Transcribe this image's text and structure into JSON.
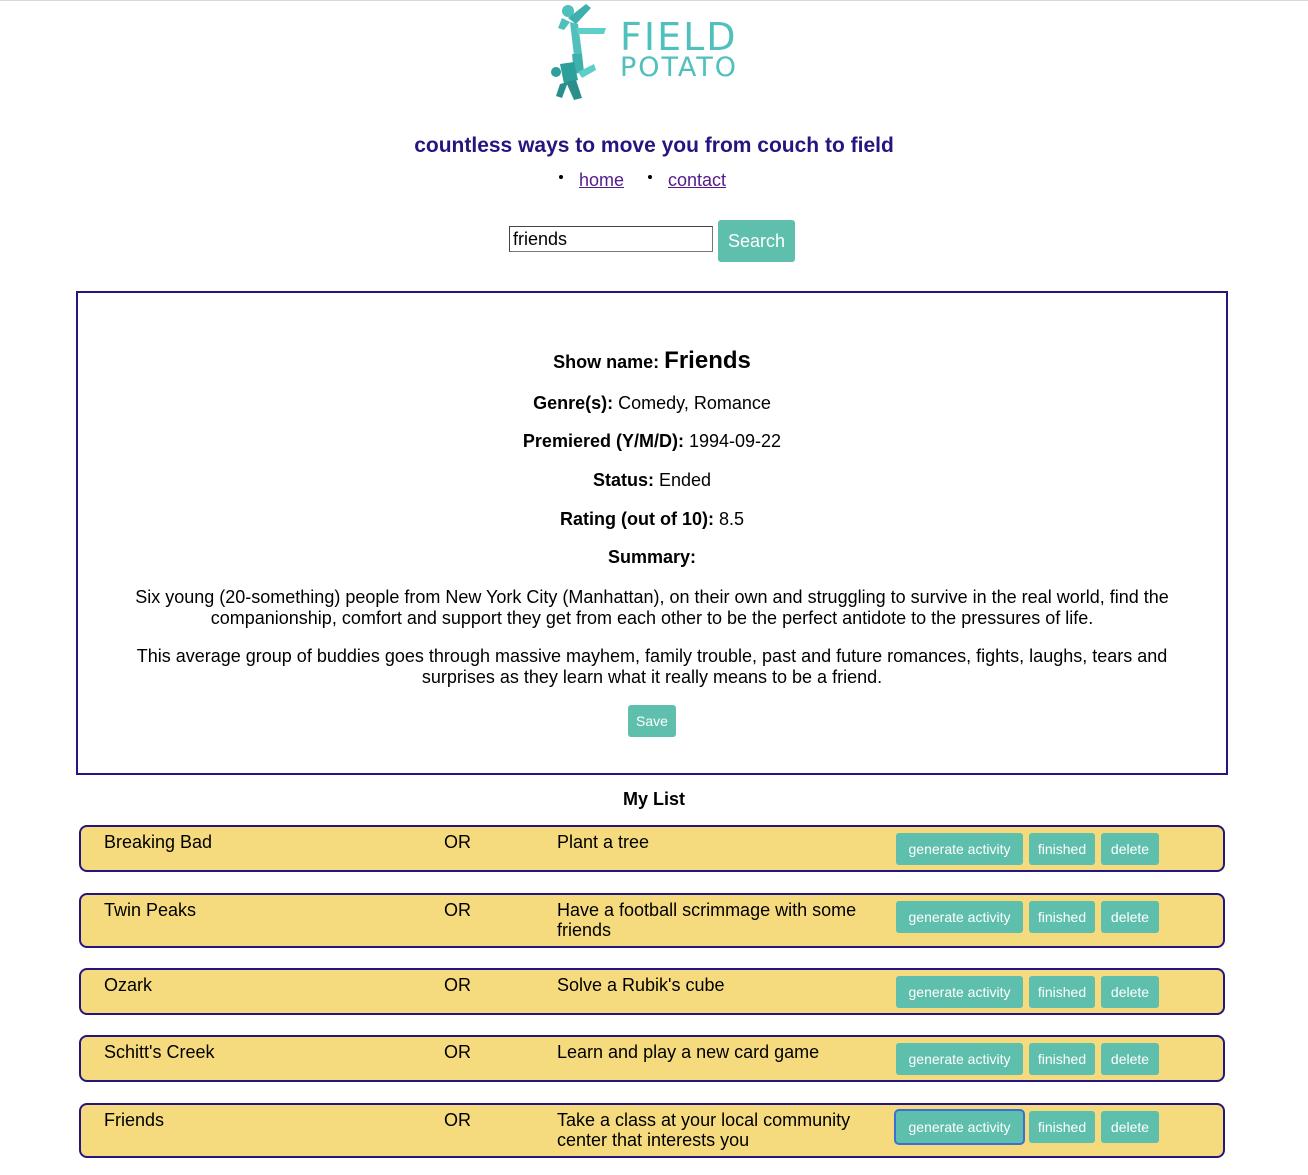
{
  "logo": {
    "line1": "FIELD",
    "line2": "POTATO",
    "color": "#4fc0bb",
    "icon": "people-jumping-logo"
  },
  "header": {
    "tagline": "countless ways to move you from couch to field",
    "nav": [
      {
        "label": "home"
      },
      {
        "label": "contact"
      }
    ]
  },
  "search": {
    "value": "friends",
    "button_label": "Search"
  },
  "show": {
    "name_label": "Show name:",
    "name": "Friends",
    "genres_label": "Genre(s):",
    "genres": "Comedy, Romance",
    "premiered_label": "Premiered (Y/M/D):",
    "premiered": "1994-09-22",
    "status_label": "Status:",
    "status": "Ended",
    "rating_label": "Rating (out of 10):",
    "rating": "8.5",
    "summary_label": "Summary:",
    "summary_p1": "Six young (20-something) people from New York City (Manhattan), on their own and struggling to survive in the real world, find the companionship, comfort and support they get from each other to be the perfect antidote to the pressures of life.",
    "summary_p2": "This average group of buddies goes through massive mayhem, family trouble, past and future romances, fights, laughs, tears and surprises as they learn what it really means to be a friend.",
    "save_label": "Save"
  },
  "mylist": {
    "title": "My List",
    "or_label": "OR",
    "generate_label": "generate activity",
    "finished_label": "finished",
    "delete_label": "delete",
    "items": [
      {
        "show": "Breaking Bad",
        "activity": "Plant a tree"
      },
      {
        "show": "Twin Peaks",
        "activity": "Have a football scrimmage with some friends"
      },
      {
        "show": "Ozark",
        "activity": "Solve a Rubik's cube"
      },
      {
        "show": "Schitt's Creek",
        "activity": "Learn and play a new card game"
      },
      {
        "show": "Friends",
        "activity": "Take a class at your local community center that interests you"
      }
    ]
  },
  "colors": {
    "accent": "#5fbfad",
    "navy": "#24157f",
    "row_bg": "#f5db7e"
  }
}
